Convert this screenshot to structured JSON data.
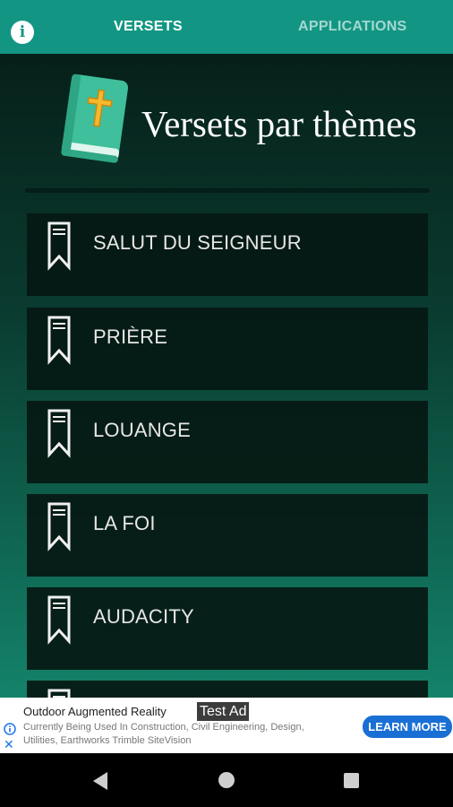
{
  "topbar": {
    "tabs": [
      {
        "label": "VERSETS",
        "active": true
      },
      {
        "label": "APPLICATIONS",
        "active": false
      }
    ],
    "info_icon": "info-icon",
    "accent_color": "#129683"
  },
  "header": {
    "title": "Versets par thèmes",
    "logo_icon": "bible-book-icon"
  },
  "themes": [
    {
      "label": "SALUT DU SEIGNEUR",
      "icon": "bookmark-icon"
    },
    {
      "label": "PRIÈRE",
      "icon": "bookmark-icon"
    },
    {
      "label": "LOUANGE",
      "icon": "bookmark-icon"
    },
    {
      "label": "LA FOI",
      "icon": "bookmark-icon"
    },
    {
      "label": "AUDACITY",
      "icon": "bookmark-icon"
    }
  ],
  "ad": {
    "title": "Outdoor Augmented Reality",
    "badge": "Test Ad",
    "description": "Currently Being Used In Construction, Civil Engineering, Design, Utilities, Earthworks Trimble SiteVision",
    "cta": "LEARN MORE"
  },
  "navbar": {
    "icons": [
      "back-icon",
      "home-icon",
      "recents-icon"
    ]
  }
}
